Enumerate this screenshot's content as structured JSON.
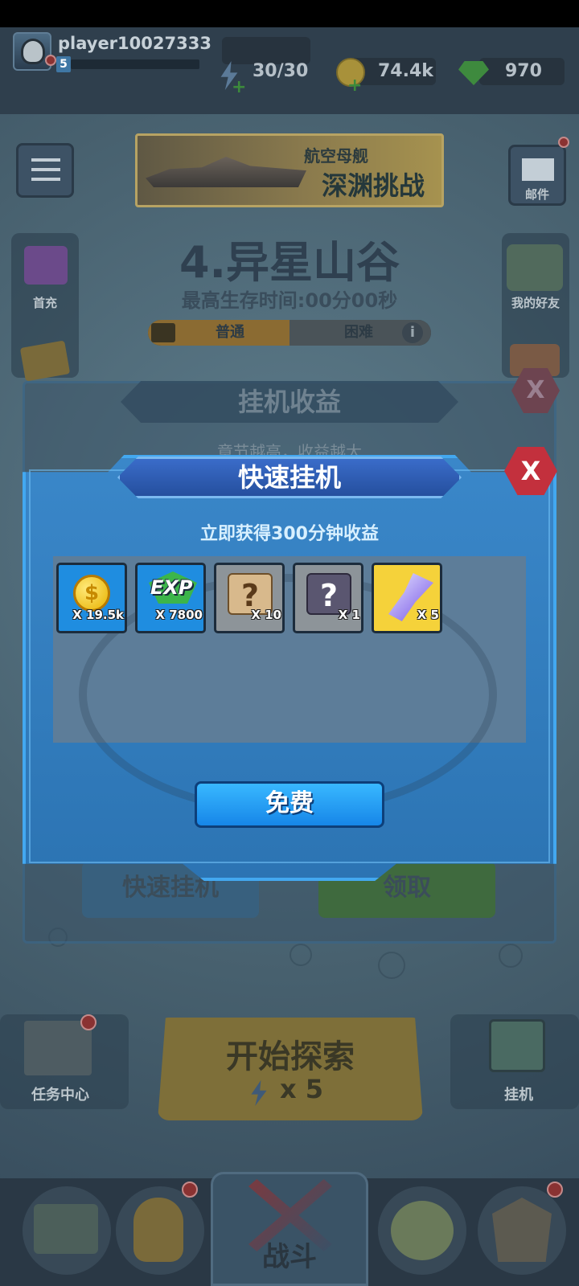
{
  "player": {
    "name": "player10027333",
    "level": "5",
    "energy": "30/30",
    "coins": "74.4k",
    "gems": "970"
  },
  "banner": {
    "line1": "航空母舰",
    "line2": "深渊挑战"
  },
  "side_left": {
    "first_charge": "首充"
  },
  "side_right": {
    "mail": "邮件",
    "friends": "我的好友"
  },
  "chapter": {
    "title": "4.异星山谷",
    "best_survival": "最高生存时间:00分00秒",
    "difficulty_normal": "普通",
    "difficulty_hard": "困难"
  },
  "idle_panel": {
    "title": "挂机收益",
    "subtitle": "章节越高，收益越大",
    "quick_btn": "快速挂机",
    "claim_btn": "领取",
    "close": "X"
  },
  "modal": {
    "title": "快速挂机",
    "subtitle": "立即获得300分钟收益",
    "close": "X",
    "free_button": "免费",
    "rewards": [
      {
        "name": "coin",
        "qty": "X 19.5k"
      },
      {
        "name": "exp",
        "qty": "X 7800",
        "label": "EXP"
      },
      {
        "name": "mystery-box",
        "qty": "X 10",
        "glyph": "?"
      },
      {
        "name": "mystery-chest",
        "qty": "X 1",
        "glyph": "?"
      },
      {
        "name": "crystal",
        "qty": "X 5"
      }
    ]
  },
  "bottom": {
    "task_center": "任务中心",
    "idle": "挂机",
    "explore": "开始探索",
    "explore_cost": "x 5",
    "battle": "战斗"
  },
  "colors": {
    "modal_blue": "#2c74b3",
    "free_button": "#1686e8",
    "close_red": "#c3303d",
    "reward_blue": "#1f8de0",
    "reward_gray": "#8d9499",
    "reward_gold": "#f5d23a"
  }
}
